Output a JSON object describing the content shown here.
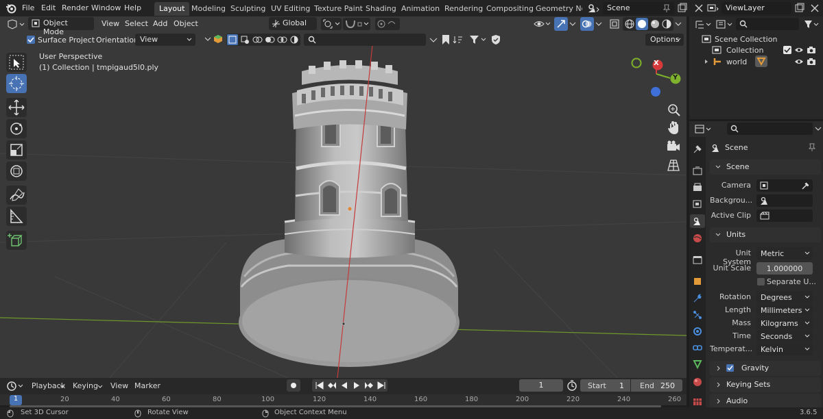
{
  "topbar": {
    "menus": [
      "File",
      "Edit",
      "Render",
      "Window",
      "Help"
    ],
    "workspaces": [
      "Layout",
      "Modeling",
      "Sculpting",
      "UV Editing",
      "Texture Paint",
      "Shading",
      "Animation",
      "Rendering",
      "Compositing",
      "Geometry Noc"
    ],
    "scene": "Scene",
    "view_layer": "ViewLayer"
  },
  "viewport": {
    "mode": "Object Mode",
    "menus": [
      "View",
      "Select",
      "Add",
      "Object"
    ],
    "transform_orientation": "Global",
    "surface_project_label": "Surface Project",
    "orientation_label": "Orientation:",
    "orientation_value": "View",
    "options_label": "Options",
    "overlay_title": "User Perspective",
    "overlay_subtitle": "(1) Collection | tmpigaud5l0.ply",
    "gizmo": {
      "x": "X",
      "y": "Y"
    }
  },
  "outliner": {
    "root": "Scene Collection",
    "items": [
      "Collection",
      "world"
    ]
  },
  "properties": {
    "context": "Scene",
    "panels": {
      "scene": {
        "title": "Scene",
        "camera_label": "Camera",
        "background_label": "Backgrou...",
        "clip_label": "Active Clip"
      },
      "units": {
        "title": "Units",
        "unit_system_label": "Unit System",
        "unit_system": "Metric",
        "unit_scale_label": "Unit Scale",
        "unit_scale": "1.000000",
        "separate_units": "Separate U...",
        "rotation_label": "Rotation",
        "rotation": "Degrees",
        "length_label": "Length",
        "length": "Millimeters",
        "mass_label": "Mass",
        "mass": "Kilograms",
        "time_label": "Time",
        "time": "Seconds",
        "temperature_label": "Temperat...",
        "temperature": "Kelvin"
      },
      "collapsed": [
        "Gravity",
        "Keying Sets",
        "Audio"
      ]
    }
  },
  "timeline": {
    "menus": [
      "Playback",
      "Keying",
      "View",
      "Marker"
    ],
    "current_frame": "1",
    "start_label": "Start",
    "start": "1",
    "end_label": "End",
    "end": "250",
    "ruler": [
      "1",
      "20",
      "40",
      "60",
      "80",
      "100",
      "120",
      "140",
      "160",
      "180",
      "200",
      "220",
      "240",
      "260"
    ]
  },
  "statusbar": {
    "hints": [
      "Set 3D Cursor",
      "Rotate View",
      "Object Context Menu"
    ],
    "version": "3.6.5"
  },
  "colors": {
    "accent": "#4772b3",
    "axis_x": "#d63a3a",
    "axis_y": "#7fb22d",
    "viewport_bg": "#393939"
  }
}
